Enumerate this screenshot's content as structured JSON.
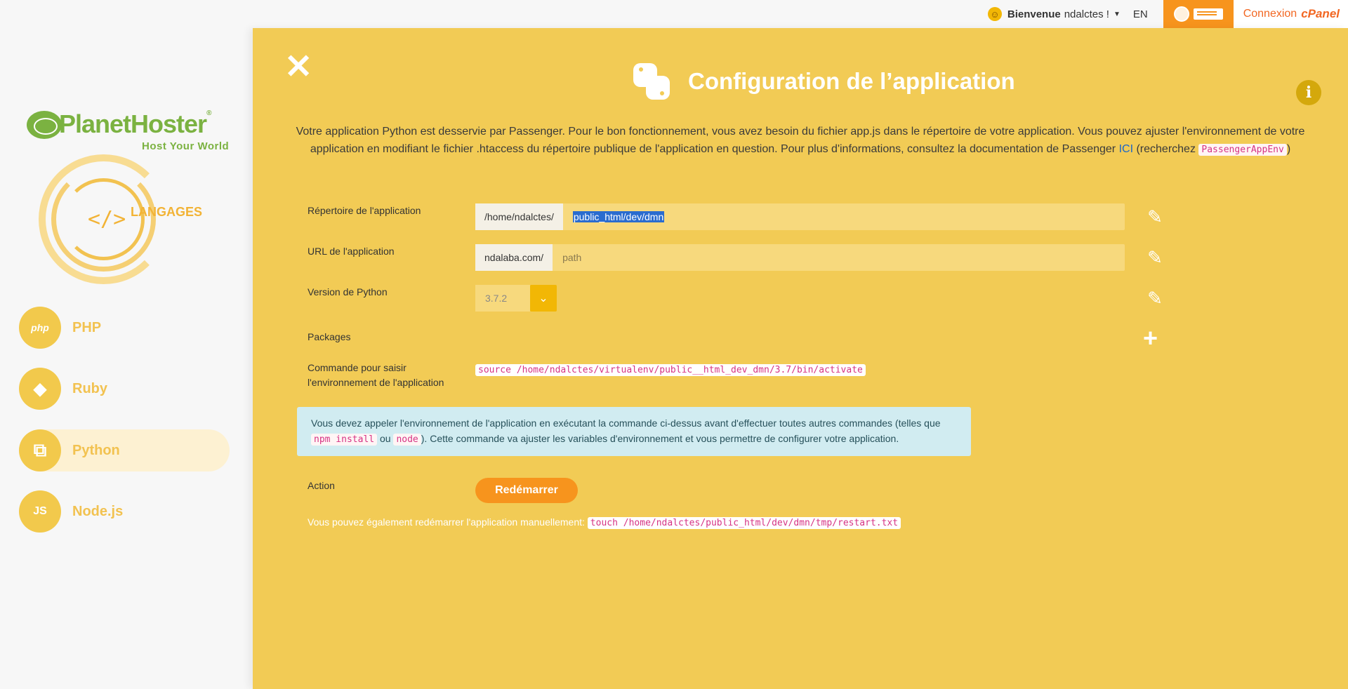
{
  "topbar": {
    "welcome_label": "Bienvenue",
    "username": "ndalctes !",
    "lang": "EN",
    "connexion_label": "Connexion",
    "cpanel_label": "cPanel"
  },
  "sidebar": {
    "logo_name": "PlanetHoster",
    "logo_tagline": "Host Your World",
    "section_label": "LANGAGES",
    "emblem_code": "</>",
    "items": [
      {
        "label": "PHP",
        "icon_text": "php"
      },
      {
        "label": "Ruby",
        "icon_text": "◆"
      },
      {
        "label": "Python",
        "icon_text": "⧉"
      },
      {
        "label": "Node.js",
        "icon_text": "JS"
      }
    ]
  },
  "main": {
    "close_glyph": "✕",
    "title": "Configuration de l’application",
    "info_glyph": "i",
    "desc_part1": "Votre application Python est desservie par Passenger. Pour le bon fonctionnement, vous avez besoin du fichier app.js dans le répertoire de votre application. Vous pouvez ajuster l'environnement de votre application en modifiant le fichier .htaccess du répertoire publique de l'application en question. Pour plus d'informations, consultez la documentation de Passenger",
    "desc_link": "ICI",
    "desc_part2": "(recherchez",
    "desc_code": "PassengerAppEnv",
    "desc_part3": ")",
    "rows": {
      "directory_label": "Répertoire de l'application",
      "directory_prefix": "/home/ndalctes/",
      "directory_value": "public_html/dev/dmn",
      "url_label": "URL de l'application",
      "url_prefix": "ndalaba.com/",
      "url_placeholder": "path",
      "python_label": "Version de Python",
      "python_value": "3.7.2",
      "packages_label": "Packages",
      "command_label_line1": "Commande pour saisir",
      "command_label_line2": "l'environnement de l'application",
      "command_value": "source /home/ndalctes/virtualenv/public__html_dev_dmn/3.7/bin/activate"
    },
    "alert": {
      "part1": "Vous devez appeler l'environnement de l'application en exécutant la commande ci-dessus avant d'effectuer toutes autres commandes (telles que",
      "code1": "npm install",
      "part2": "ou",
      "code2": "node",
      "part3": "). Cette commande va ajuster les variables d'environnement et vous permettre de configurer votre application."
    },
    "action_label": "Action",
    "restart_label": "Redémarrer",
    "manual_text": "Vous pouvez également redémarrer l'application manuellement:",
    "manual_code": "touch /home/ndalctes/public_html/dev/dmn/tmp/restart.txt"
  },
  "colors": {
    "main_bg": "#f2cb55",
    "accent_orange": "#f7941d",
    "brand_green": "#7bb241",
    "nav_yellow": "#f2c94c"
  }
}
